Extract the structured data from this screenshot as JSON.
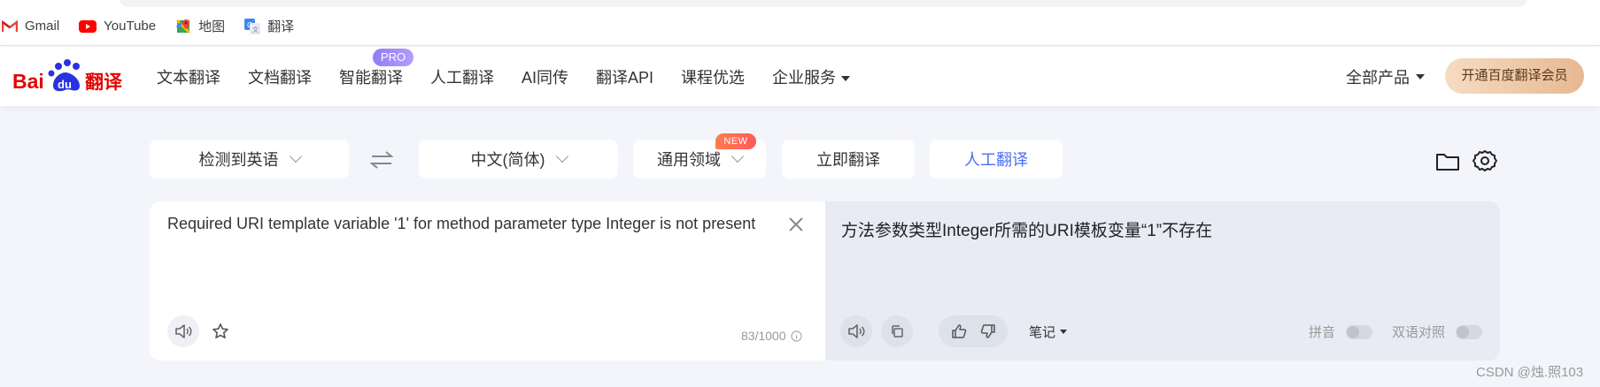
{
  "bookmarks": [
    {
      "label": "Gmail",
      "icon": "gmail-icon"
    },
    {
      "label": "YouTube",
      "icon": "youtube-icon"
    },
    {
      "label": "地图",
      "icon": "maps-icon"
    },
    {
      "label": "翻译",
      "icon": "translate-icon"
    }
  ],
  "nav": {
    "logo_text": "Bai du 翻译",
    "items": [
      "文本翻译",
      "文档翻译",
      "智能翻译",
      "人工翻译",
      "AI同传",
      "翻译API",
      "课程优选",
      "企业服务"
    ],
    "pro_badge": "PRO",
    "all_products": "全部产品",
    "member_button": "开通百度翻译会员"
  },
  "toolbar": {
    "source_lang": "检测到英语",
    "target_lang": "中文(简体)",
    "domain": "通用领域",
    "new_badge": "NEW",
    "translate_now": "立即翻译",
    "human_translate": "人工翻译"
  },
  "source": {
    "text": "Required URI template variable '1' for method parameter type Integer is not present",
    "counter": "83/1000"
  },
  "target": {
    "text": "方法参数类型Integer所需的URI模板变量“1”不存在",
    "notes": "笔记",
    "pinyin": "拼音",
    "bilingual": "双语对照"
  },
  "watermark": "CSDN @烛.照103",
  "colors": {
    "accent_blue": "#4e6ef2",
    "baidu_red": "#e10602",
    "panel_right_bg": "#e8ebf3",
    "page_bg": "#f3f5fb"
  }
}
